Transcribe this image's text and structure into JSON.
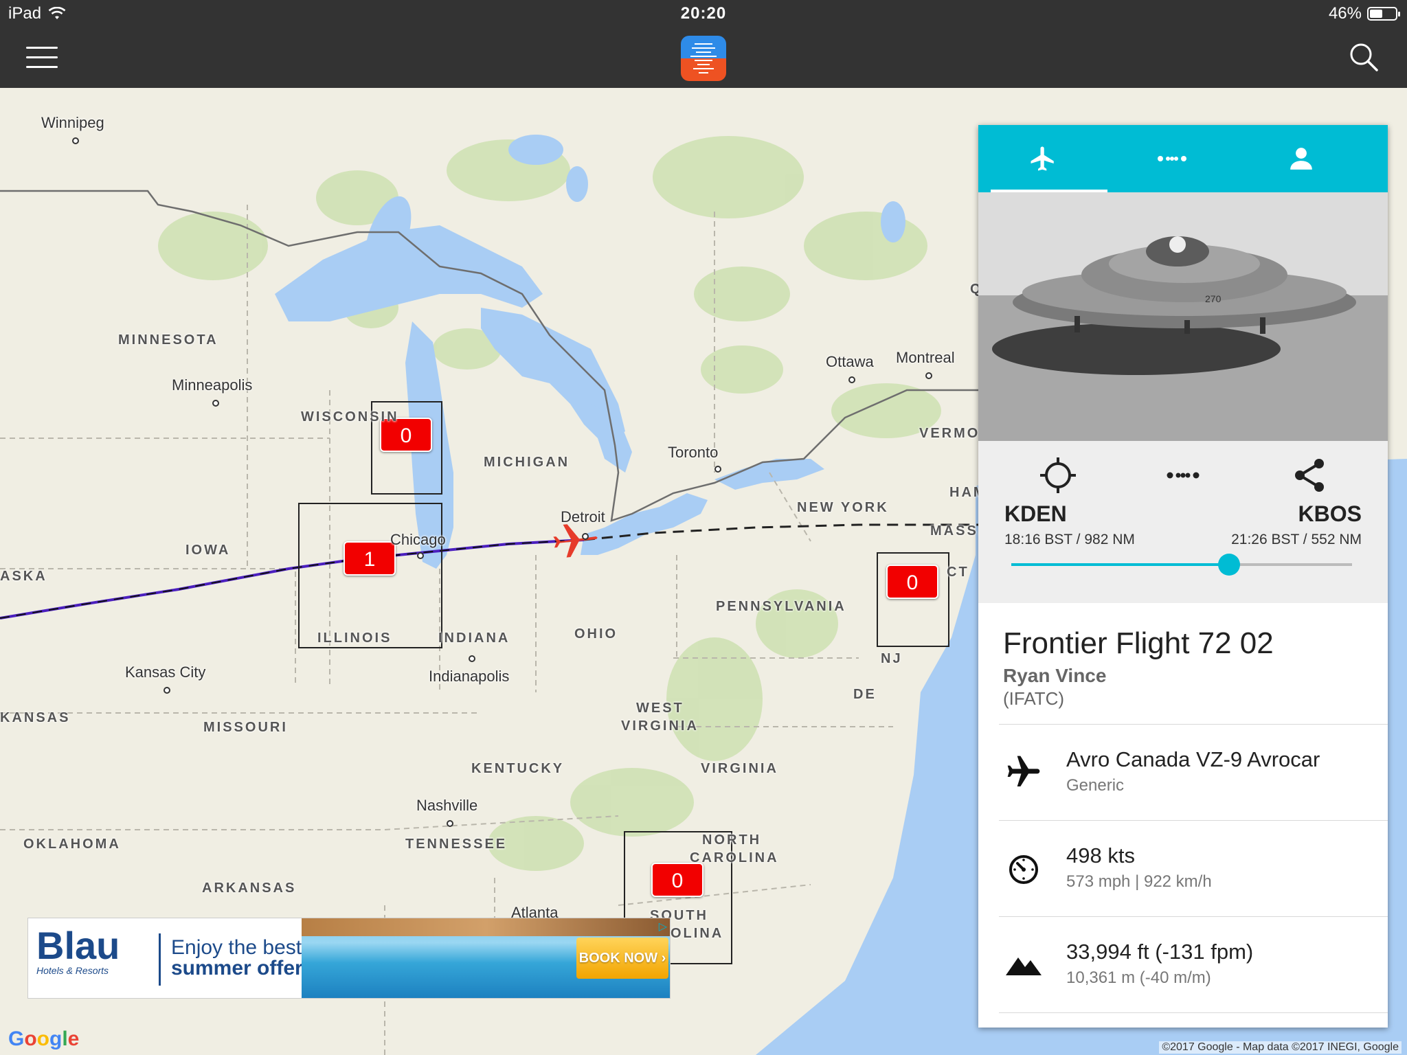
{
  "status_bar": {
    "device": "iPad",
    "time": "20:20",
    "battery": "46%"
  },
  "app": {
    "logo_name": "flight-app-logo"
  },
  "map": {
    "cities": [
      {
        "name": "Winnipeg"
      },
      {
        "name": "Minneapolis"
      },
      {
        "name": "Chicago"
      },
      {
        "name": "Detroit"
      },
      {
        "name": "Toronto"
      },
      {
        "name": "Ottawa"
      },
      {
        "name": "Montreal"
      },
      {
        "name": "Kansas City"
      },
      {
        "name": "Indianapolis"
      },
      {
        "name": "Nashville"
      },
      {
        "name": "Atlanta"
      }
    ],
    "states": [
      {
        "name": "MINNESOTA"
      },
      {
        "name": "WISCONSIN"
      },
      {
        "name": "MICHIGAN"
      },
      {
        "name": "IOWA"
      },
      {
        "name": "ILLINOIS"
      },
      {
        "name": "INDIANA"
      },
      {
        "name": "OHIO"
      },
      {
        "name": "PENNSYLVANIA"
      },
      {
        "name": "NEW YORK"
      },
      {
        "name": "MISSOURI"
      },
      {
        "name": "KANSAS"
      },
      {
        "name": "KENTUCKY"
      },
      {
        "name": "WEST"
      },
      {
        "name": "VIRGINIA"
      },
      {
        "name": "VIRGINIA"
      },
      {
        "name": "TENNESSEE"
      },
      {
        "name": "OKLAHOMA"
      },
      {
        "name": "ARKANSAS"
      },
      {
        "name": "NORTH"
      },
      {
        "name": "CAROLINA"
      },
      {
        "name": "SOUTH"
      },
      {
        "name": "OLINA"
      },
      {
        "name": "ASKA"
      },
      {
        "name": "NJ"
      },
      {
        "name": "DE"
      },
      {
        "name": "CT"
      },
      {
        "name": "MASS."
      },
      {
        "name": "VERMO"
      },
      {
        "name": "HAM"
      },
      {
        "name": "Q"
      }
    ],
    "region_counts": [
      "0",
      "1",
      "0",
      "0"
    ],
    "copyright": "©2017 Google - Map data ©2017 INEGI, Google",
    "google_logo": "Google"
  },
  "ad": {
    "brand": "Blau",
    "brand_sub": "Hotels & Resorts",
    "tagline_1": "Enjoy the best",
    "tagline_2": "summer offers!",
    "cta": "BOOK NOW ›"
  },
  "panel": {
    "tabs": [
      {
        "icon": "airplane-icon",
        "active": true
      },
      {
        "icon": "route-icon",
        "active": false
      },
      {
        "icon": "person-icon",
        "active": false
      }
    ],
    "origin": {
      "code": "KDEN",
      "sub": "18:16 BST / 982 NM"
    },
    "destination": {
      "code": "KBOS",
      "sub": "21:26 BST / 552 NM"
    },
    "progress": 0.64,
    "flight_name": "Frontier Flight 72 02",
    "pilot": "Ryan Vince",
    "server": "(IFATC)",
    "aircraft": {
      "name": "Avro Canada VZ-9 Avrocar",
      "livery": "Generic"
    },
    "speed": {
      "main": "498 kts",
      "sub": "573 mph | 922 km/h"
    },
    "altitude": {
      "main": "33,994 ft (-131 fpm)",
      "sub": "10,361 m (-40 m/m)"
    }
  },
  "colors": {
    "accent": "#00bcd4",
    "badge": "#f20000",
    "topbar": "#333333",
    "water": "#a9cdf4"
  }
}
